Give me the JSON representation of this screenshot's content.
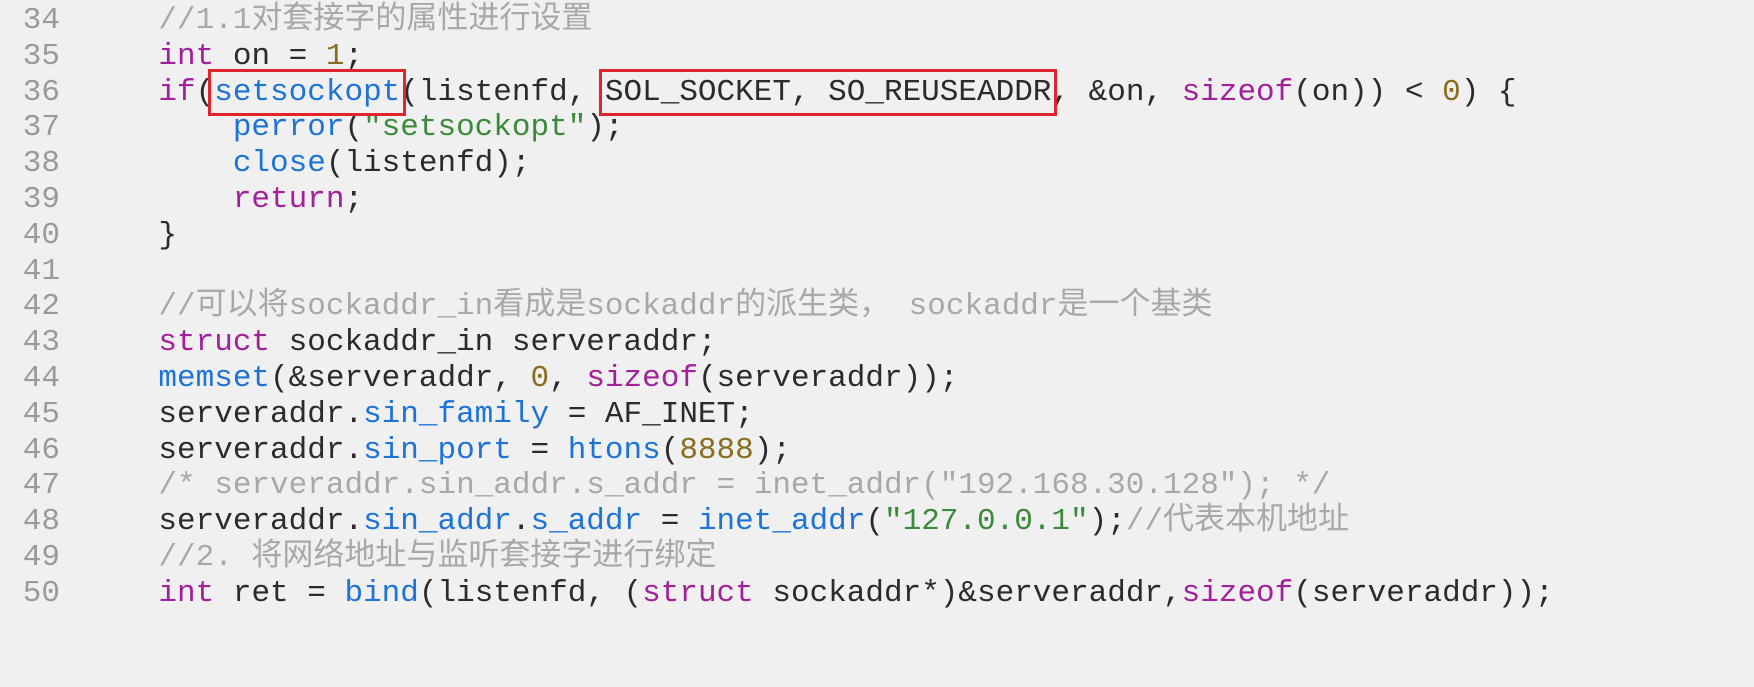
{
  "colors": {
    "background": "#f0f0f0",
    "line_number": "#9a9a9a",
    "keyword": "#a3209b",
    "function": "#1e73d6",
    "number": "#8a6d1e",
    "string": "#3a8a3a",
    "comment": "#a8a8a8",
    "plain": "#2b2b2b",
    "highlight_box": "#e0242c"
  },
  "lines": [
    {
      "num": "34",
      "indent": "    ",
      "tokens": [
        {
          "t": "cmt",
          "v": "//1.1对套接字的属性进行设置"
        }
      ]
    },
    {
      "num": "35",
      "indent": "    ",
      "tokens": [
        {
          "t": "kw",
          "v": "int"
        },
        {
          "t": "plain",
          "v": " on = "
        },
        {
          "t": "num",
          "v": "1"
        },
        {
          "t": "plain",
          "v": ";"
        }
      ]
    },
    {
      "num": "36",
      "indent": "    ",
      "tokens": [
        {
          "t": "kw",
          "v": "if"
        },
        {
          "t": "plain",
          "v": "("
        },
        {
          "t": "fn",
          "v": "setsockopt",
          "box": "box-setsockopt"
        },
        {
          "t": "plain",
          "v": "(listenfd, "
        },
        {
          "t": "plain",
          "v": "SOL_SOCKET, SO_REUSEADDR",
          "box": "box-sol-socket"
        },
        {
          "t": "plain",
          "v": ", &on, "
        },
        {
          "t": "kw",
          "v": "sizeof"
        },
        {
          "t": "plain",
          "v": "(on)) < "
        },
        {
          "t": "num",
          "v": "0"
        },
        {
          "t": "plain",
          "v": ") {"
        }
      ]
    },
    {
      "num": "37",
      "indent": "        ",
      "tokens": [
        {
          "t": "fn",
          "v": "perror"
        },
        {
          "t": "plain",
          "v": "("
        },
        {
          "t": "str",
          "v": "\"setsockopt\""
        },
        {
          "t": "plain",
          "v": ");"
        }
      ]
    },
    {
      "num": "38",
      "indent": "        ",
      "tokens": [
        {
          "t": "fn",
          "v": "close"
        },
        {
          "t": "plain",
          "v": "(listenfd);"
        }
      ]
    },
    {
      "num": "39",
      "indent": "        ",
      "tokens": [
        {
          "t": "kw",
          "v": "return"
        },
        {
          "t": "plain",
          "v": ";"
        }
      ]
    },
    {
      "num": "40",
      "indent": "    ",
      "tokens": [
        {
          "t": "plain",
          "v": "}"
        }
      ]
    },
    {
      "num": "41",
      "indent": "",
      "tokens": []
    },
    {
      "num": "42",
      "indent": "    ",
      "tokens": [
        {
          "t": "cmt",
          "v": "//可以将sockaddr_in看成是sockaddr的派生类， sockaddr是一个基类"
        }
      ]
    },
    {
      "num": "43",
      "indent": "    ",
      "tokens": [
        {
          "t": "kw",
          "v": "struct"
        },
        {
          "t": "plain",
          "v": " sockaddr_in serveraddr;"
        }
      ]
    },
    {
      "num": "44",
      "indent": "    ",
      "tokens": [
        {
          "t": "fn",
          "v": "memset"
        },
        {
          "t": "plain",
          "v": "(&serveraddr, "
        },
        {
          "t": "num",
          "v": "0"
        },
        {
          "t": "plain",
          "v": ", "
        },
        {
          "t": "kw",
          "v": "sizeof"
        },
        {
          "t": "plain",
          "v": "(serveraddr));"
        }
      ]
    },
    {
      "num": "45",
      "indent": "    ",
      "tokens": [
        {
          "t": "plain",
          "v": "serveraddr."
        },
        {
          "t": "mem",
          "v": "sin_family"
        },
        {
          "t": "plain",
          "v": " = AF_INET;"
        }
      ]
    },
    {
      "num": "46",
      "indent": "    ",
      "tokens": [
        {
          "t": "plain",
          "v": "serveraddr."
        },
        {
          "t": "mem",
          "v": "sin_port"
        },
        {
          "t": "plain",
          "v": " = "
        },
        {
          "t": "fn",
          "v": "htons"
        },
        {
          "t": "plain",
          "v": "("
        },
        {
          "t": "num",
          "v": "8888"
        },
        {
          "t": "plain",
          "v": ");"
        }
      ]
    },
    {
      "num": "47",
      "indent": "    ",
      "tokens": [
        {
          "t": "cmt",
          "v": "/* serveraddr.sin_addr.s_addr = inet_addr(\"192.168.30.128\"); */"
        }
      ]
    },
    {
      "num": "48",
      "indent": "    ",
      "tokens": [
        {
          "t": "plain",
          "v": "serveraddr."
        },
        {
          "t": "mem",
          "v": "sin_addr"
        },
        {
          "t": "plain",
          "v": "."
        },
        {
          "t": "mem",
          "v": "s_addr"
        },
        {
          "t": "plain",
          "v": " = "
        },
        {
          "t": "fn",
          "v": "inet_addr"
        },
        {
          "t": "plain",
          "v": "("
        },
        {
          "t": "str",
          "v": "\"127.0.0.1\""
        },
        {
          "t": "plain",
          "v": ");"
        },
        {
          "t": "cmt",
          "v": "//代表本机地址"
        }
      ]
    },
    {
      "num": "49",
      "indent": "    ",
      "tokens": [
        {
          "t": "cmt",
          "v": "//2. 将网络地址与监听套接字进行绑定"
        }
      ]
    },
    {
      "num": "50",
      "indent": "    ",
      "tokens": [
        {
          "t": "kw",
          "v": "int"
        },
        {
          "t": "plain",
          "v": " ret = "
        },
        {
          "t": "fn",
          "v": "bind"
        },
        {
          "t": "plain",
          "v": "(listenfd, ("
        },
        {
          "t": "kw",
          "v": "struct"
        },
        {
          "t": "plain",
          "v": " sockaddr*)&serveraddr,"
        },
        {
          "t": "kw",
          "v": "sizeof"
        },
        {
          "t": "plain",
          "v": "(serveraddr));"
        }
      ]
    }
  ]
}
